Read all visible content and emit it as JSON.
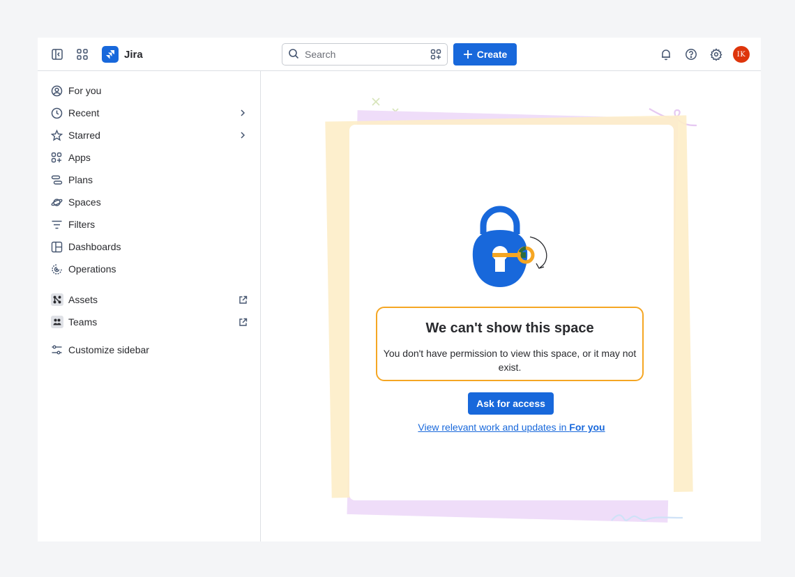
{
  "topbar": {
    "app_name": "Jira",
    "search_placeholder": "Search",
    "create_label": "Create",
    "avatar_initials": "IK"
  },
  "sidebar": {
    "items": [
      {
        "label": "For you",
        "icon": "user-circle-icon"
      },
      {
        "label": "Recent",
        "icon": "clock-icon",
        "chevron": true
      },
      {
        "label": "Starred",
        "icon": "star-icon",
        "chevron": true
      },
      {
        "label": "Apps",
        "icon": "apps-icon"
      },
      {
        "label": "Plans",
        "icon": "plans-icon"
      },
      {
        "label": "Spaces",
        "icon": "planet-icon"
      },
      {
        "label": "Filters",
        "icon": "filter-icon"
      },
      {
        "label": "Dashboards",
        "icon": "dashboard-icon"
      },
      {
        "label": "Operations",
        "icon": "operations-icon"
      },
      {
        "label": "Assets",
        "icon": "assets-icon",
        "external": true
      },
      {
        "label": "Teams",
        "icon": "teams-icon",
        "external": true
      },
      {
        "label": "Customize sidebar",
        "icon": "customize-icon"
      }
    ]
  },
  "main": {
    "title": "We can't show this space",
    "body": "You don't have permission to view this space, or it may not exist.",
    "ask_button": "Ask for access",
    "link_prefix": "View relevant work and updates in ",
    "link_bold": "For you"
  },
  "colors": {
    "brand": "#1868db",
    "highlight": "#f5a623",
    "avatar": "#de350b"
  }
}
